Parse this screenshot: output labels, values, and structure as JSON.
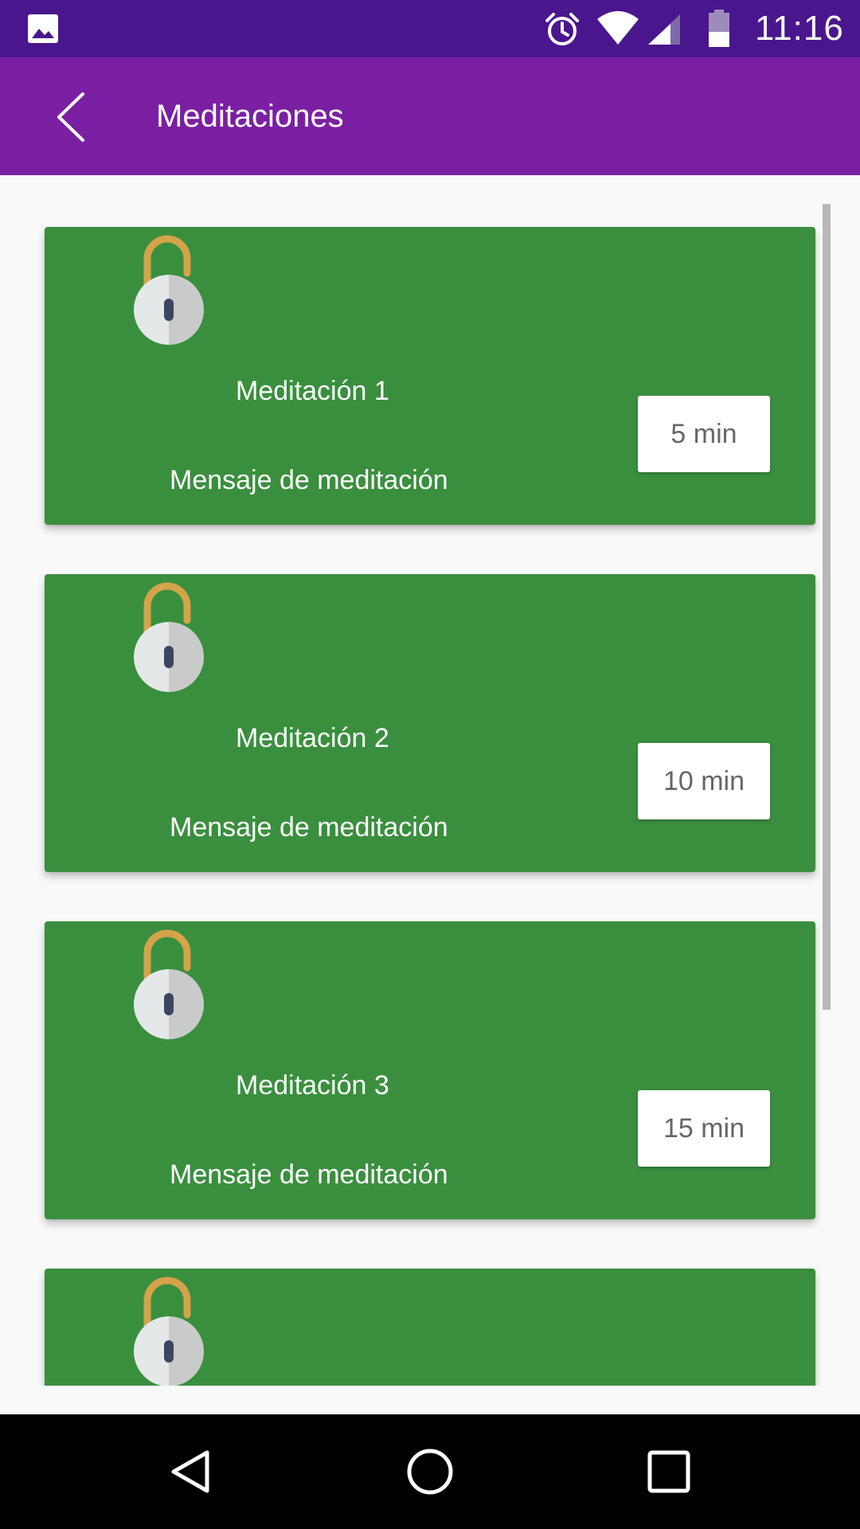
{
  "status_bar": {
    "time": "11:16",
    "icons": [
      "gallery-icon",
      "alarm-icon",
      "wifi-icon",
      "signal-icon",
      "battery-icon"
    ]
  },
  "app_bar": {
    "back_icon": "back-arrow-icon",
    "title": "Meditaciones"
  },
  "colors": {
    "status_bar": "#4a168e",
    "app_bar": "#7b1fa2",
    "card": "#3a8f3e",
    "lock_shackle": "#d4a34a"
  },
  "meditations": [
    {
      "name": "Meditación 1",
      "message": "Mensaje de meditación",
      "duration": "5 min",
      "icon": "unlocked-padlock-icon"
    },
    {
      "name": "Meditación 2",
      "message": "Mensaje de meditación",
      "duration": "10 min",
      "icon": "unlocked-padlock-icon"
    },
    {
      "name": "Meditación 3",
      "message": "Mensaje de meditación",
      "duration": "15 min",
      "icon": "unlocked-padlock-icon"
    },
    {
      "name": "",
      "message": "",
      "duration": "",
      "icon": "unlocked-padlock-icon"
    }
  ],
  "nav_bar": {
    "icons": [
      "back-triangle-icon",
      "home-circle-icon",
      "recents-square-icon"
    ]
  }
}
